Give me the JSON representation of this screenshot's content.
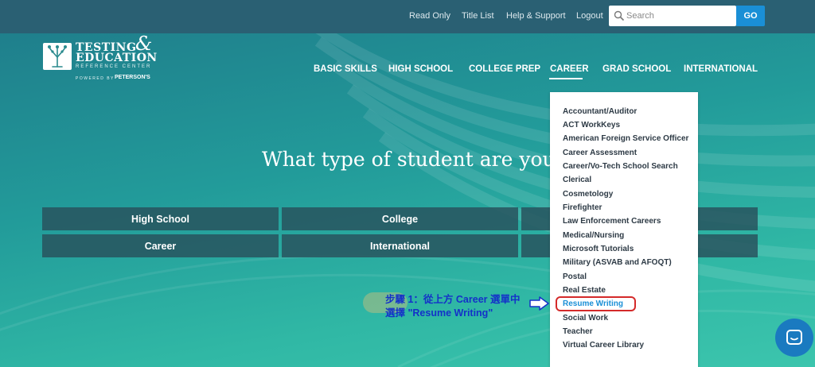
{
  "topbar": {
    "links": [
      "Read Only",
      "Title List",
      "Help & Support",
      "Logout"
    ],
    "search_placeholder": "Search",
    "go_label": "GO"
  },
  "logo": {
    "line1": "TESTING",
    "ampersand": "&",
    "line2": "EDUCATION",
    "subtitle": "REFERENCE CENTER",
    "powered_by": "POWERED BY",
    "brand": "PETERSON'S"
  },
  "nav": {
    "items": [
      "BASIC SKILLS",
      "HIGH SCHOOL",
      "COLLEGE PREP",
      "CAREER",
      "GRAD SCHOOL",
      "INTERNATIONAL"
    ],
    "active": "CAREER"
  },
  "hero": {
    "title": "What type of student are you?",
    "buttons": [
      "High School",
      "College",
      "Career",
      "International"
    ]
  },
  "career_menu": {
    "items": [
      "Accountant/Auditor",
      "ACT WorkKeys",
      "American Foreign Service Officer",
      "Career Assessment",
      "Career/Vo-Tech School Search",
      "Clerical",
      "Cosmetology",
      "Firefighter",
      "Law Enforcement Careers",
      "Medical/Nursing",
      "Microsoft Tutorials",
      "Military (ASVAB and AFOQT)",
      "Postal",
      "Real Estate",
      "Resume Writing",
      "Social Work",
      "Teacher",
      "Virtual Career Library"
    ],
    "highlighted": "Resume Writing"
  },
  "annotation": {
    "line1": "步驟 1：從上方 Career 選單中",
    "line2": "選擇 \"Resume Writing\""
  },
  "colors": {
    "topbar": "#2a6073",
    "accent_blue": "#1a8fd6",
    "highlight_red": "#d42a2a",
    "annotation_blue": "#1431c9"
  },
  "icons": [
    "search-icon",
    "logo-tree-icon",
    "arrow-right-icon",
    "chat-icon"
  ]
}
